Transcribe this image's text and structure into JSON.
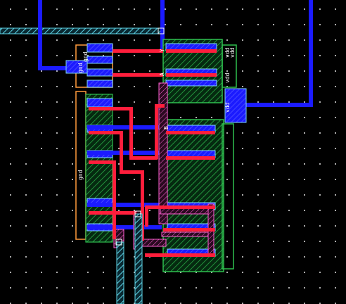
{
  "window": {
    "title": ""
  },
  "labels": {
    "gnd_1": "gnd",
    "gnd_2": "gnd",
    "gnd_3": "gnd",
    "vdd_1": "vdd",
    "vdd_2": "vdd",
    "vdd_3": "vdd",
    "vdd_4": "vdd",
    "mark_a": "Y",
    "mark_b": "A",
    "mark_c": "B"
  },
  "colors": {
    "background": "#000000",
    "grid_dot": "#c8c8c8",
    "metal1": "#1b1bff",
    "metal2": "#ff1e3c",
    "poly": "#ff5fd2",
    "diffusion_n": "#28c850",
    "well": "#ff9b3c",
    "contact": "#7fd8ff",
    "label": "#ffffff"
  }
}
